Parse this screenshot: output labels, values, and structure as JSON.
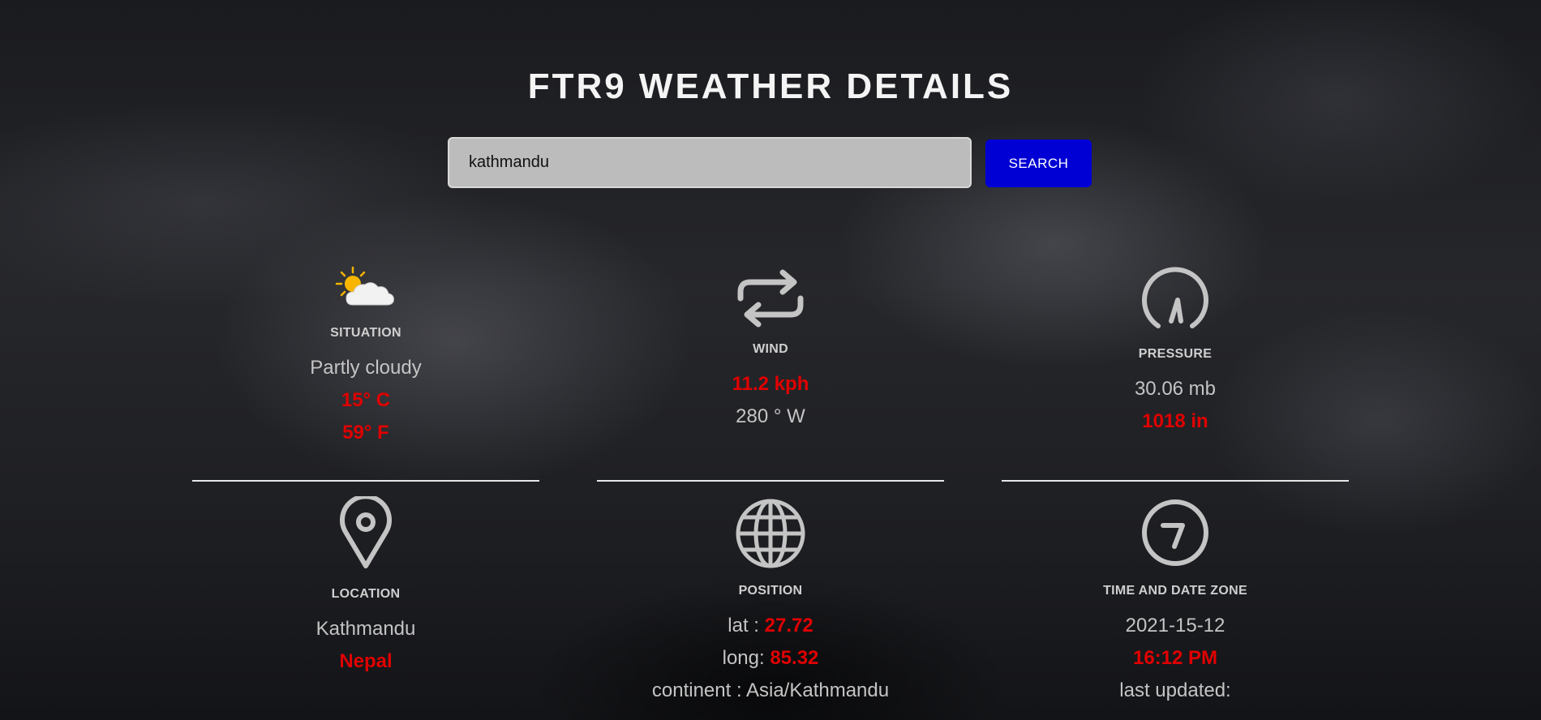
{
  "header": {
    "title": "FTR9 WEATHER DETAILS"
  },
  "search": {
    "value": "kathmandu",
    "button_label": "SEARCH"
  },
  "situation": {
    "label": "SITUATION",
    "condition": "Partly cloudy",
    "temp_c": "15° C",
    "temp_f": "59° F",
    "icon": "partly-cloudy-icon"
  },
  "wind": {
    "label": "WIND",
    "speed": "11.2 kph",
    "direction": "280 ° W",
    "icon": "wind-arrows-icon"
  },
  "pressure": {
    "label": "PRESSURE",
    "mb": "30.06 mb",
    "in": "1018 in",
    "icon": "gauge-icon"
  },
  "location": {
    "label": "LOCATION",
    "city": "Kathmandu",
    "country": "Nepal",
    "icon": "map-pin-icon"
  },
  "position": {
    "label": "POSITION",
    "lat_label": "lat : ",
    "lat": "27.72",
    "long_label": "long: ",
    "long": "85.32",
    "continent": "continent : Asia/Kathmandu",
    "icon": "globe-icon"
  },
  "time": {
    "label": "TIME AND DATE ZONE",
    "date": "2021-15-12",
    "time": "16:12 PM",
    "updated": "last updated:",
    "icon": "clock-icon"
  },
  "colors": {
    "accent_red": "#e00000",
    "button_blue": "#0000d4"
  }
}
